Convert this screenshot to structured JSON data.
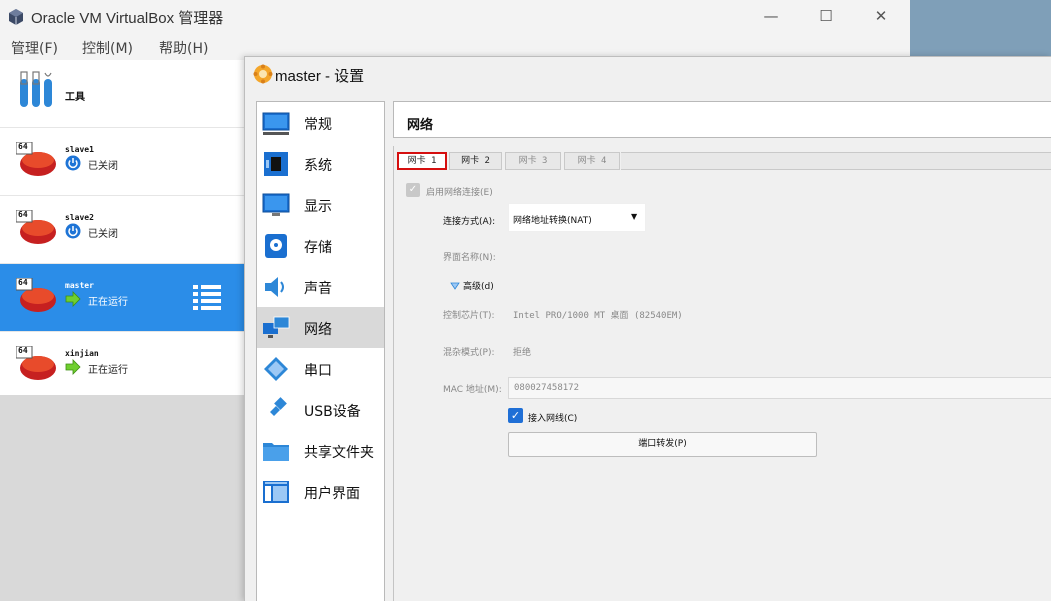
{
  "window": {
    "title": "Oracle VM VirtualBox 管理器",
    "minimize": "—",
    "maximize": "☐",
    "close": "✕"
  },
  "menu": [
    {
      "label": "管理(F)"
    },
    {
      "label": "控制(M)"
    },
    {
      "label": "帮助(H)"
    }
  ],
  "vm_list": {
    "tools_label": "工具",
    "vms": [
      {
        "name": "slave1",
        "state": "已关闭",
        "badge": "64",
        "icon": "power-off-icon"
      },
      {
        "name": "slave2",
        "state": "已关闭",
        "badge": "64",
        "icon": "power-off-icon"
      },
      {
        "name": "master",
        "state": "正在运行",
        "badge": "64",
        "icon": "running-arrow-icon",
        "selected": true
      },
      {
        "name": "xinjian",
        "state": "正在运行",
        "badge": "64",
        "icon": "running-arrow-icon"
      }
    ]
  },
  "dialog": {
    "title": "master - 设置",
    "categories": [
      {
        "label": "常规",
        "icon": "general-icon"
      },
      {
        "label": "系统",
        "icon": "system-icon"
      },
      {
        "label": "显示",
        "icon": "display-icon"
      },
      {
        "label": "存储",
        "icon": "storage-icon"
      },
      {
        "label": "声音",
        "icon": "audio-icon"
      },
      {
        "label": "网络",
        "icon": "network-icon",
        "selected": true
      },
      {
        "label": "串口",
        "icon": "serial-port-icon"
      },
      {
        "label": "USB设备",
        "icon": "usb-icon"
      },
      {
        "label": "共享文件夹",
        "icon": "shared-folder-icon"
      },
      {
        "label": "用户界面",
        "icon": "user-interface-icon"
      }
    ],
    "page_heading": "网络",
    "tabs": [
      {
        "label": "网卡 1",
        "active": true
      },
      {
        "label": "网卡 2",
        "active": false
      },
      {
        "label": "网卡 3",
        "active": false,
        "disabled": true
      },
      {
        "label": "网卡 4",
        "active": false,
        "disabled": true
      }
    ],
    "enable_adapter_label": "启用网络连接(E)",
    "attached_to_label": "连接方式(A):",
    "attached_to_value": "网络地址转换(NAT)",
    "interface_name_label": "界面名称(N):",
    "advanced_label": "高级(d)",
    "adapter_type_label": "控制芯片(T):",
    "adapter_type_value": "Intel PRO/1000 MT 桌面 (82540EM)",
    "promiscuous_label": "混杂模式(P):",
    "promiscuous_value": "拒绝",
    "mac_label": "MAC 地址(M):",
    "mac_value": "080027458172",
    "cable_connected_label": "接入网线(C)",
    "port_forwarding_label": "端口转发(P)"
  },
  "colors": {
    "selection_blue": "#2b8de8",
    "active_tab_border": "#d50f0f",
    "checkbox_blue": "#1f6fd6"
  }
}
